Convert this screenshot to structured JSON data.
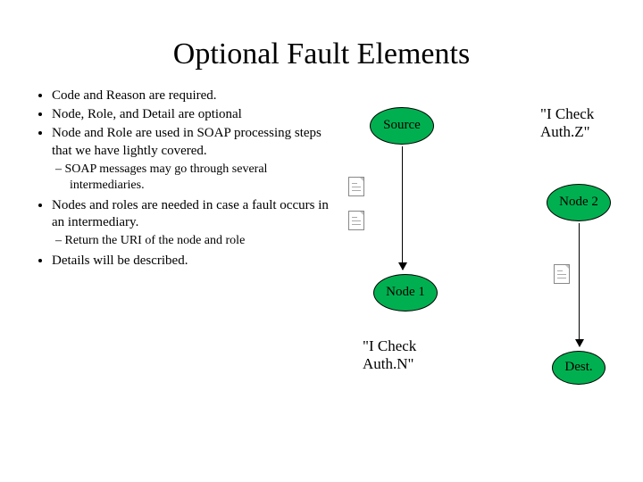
{
  "title": "Optional Fault Elements",
  "bullets": {
    "b1": "Code and Reason are required.",
    "b2": "Node, Role, and Detail are optional",
    "b3": "Node and Role are used in SOAP processing steps that we have lightly covered.",
    "b3a": "SOAP messages may go through several intermediaries.",
    "b4": "Nodes and roles are needed in case a fault occurs in an intermediary.",
    "b4a": "Return the URI of the node and role",
    "b5": "Details will be described."
  },
  "diagram": {
    "source": "Source",
    "node1": "Node 1",
    "node2": "Node 2",
    "dest": "Dest.",
    "label_authz": "\"I Check\nAuth.Z\"",
    "label_authn": "\"I Check\nAuth.N\""
  }
}
